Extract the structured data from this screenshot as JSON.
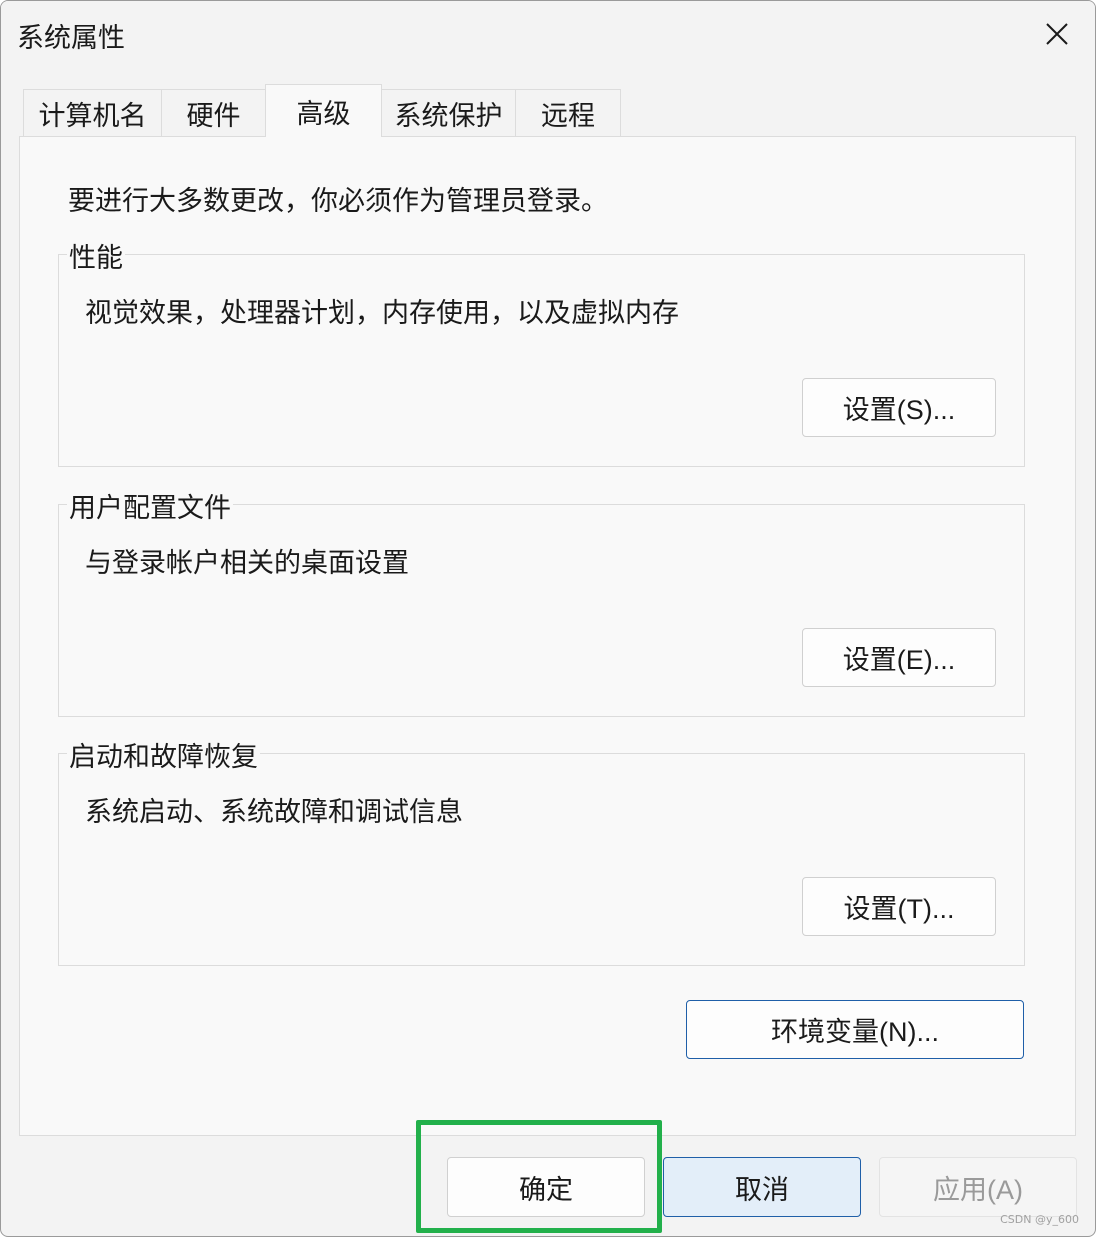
{
  "window": {
    "title": "系统属性"
  },
  "tabs": [
    {
      "label": "计算机名",
      "active": false
    },
    {
      "label": "硬件",
      "active": false
    },
    {
      "label": "高级",
      "active": true
    },
    {
      "label": "系统保护",
      "active": false
    },
    {
      "label": "远程",
      "active": false
    }
  ],
  "notice": "要进行大多数更改，你必须作为管理员登录。",
  "groups": [
    {
      "title": "性能",
      "description": "视觉效果，处理器计划，内存使用，以及虚拟内存",
      "button": "设置(S)..."
    },
    {
      "title": "用户配置文件",
      "description": "与登录帐户相关的桌面设置",
      "button": "设置(E)..."
    },
    {
      "title": "启动和故障恢复",
      "description": "系统启动、系统故障和调试信息",
      "button": "设置(T)..."
    }
  ],
  "env_button": "环境变量(N)...",
  "footer": {
    "ok": "确定",
    "cancel": "取消",
    "apply": "应用(A)"
  },
  "watermark": "CSDN @y_600",
  "colors": {
    "highlight": "#22b04b",
    "accent_border": "#1f5fa8",
    "cancel_bg": "#e3eef9"
  }
}
